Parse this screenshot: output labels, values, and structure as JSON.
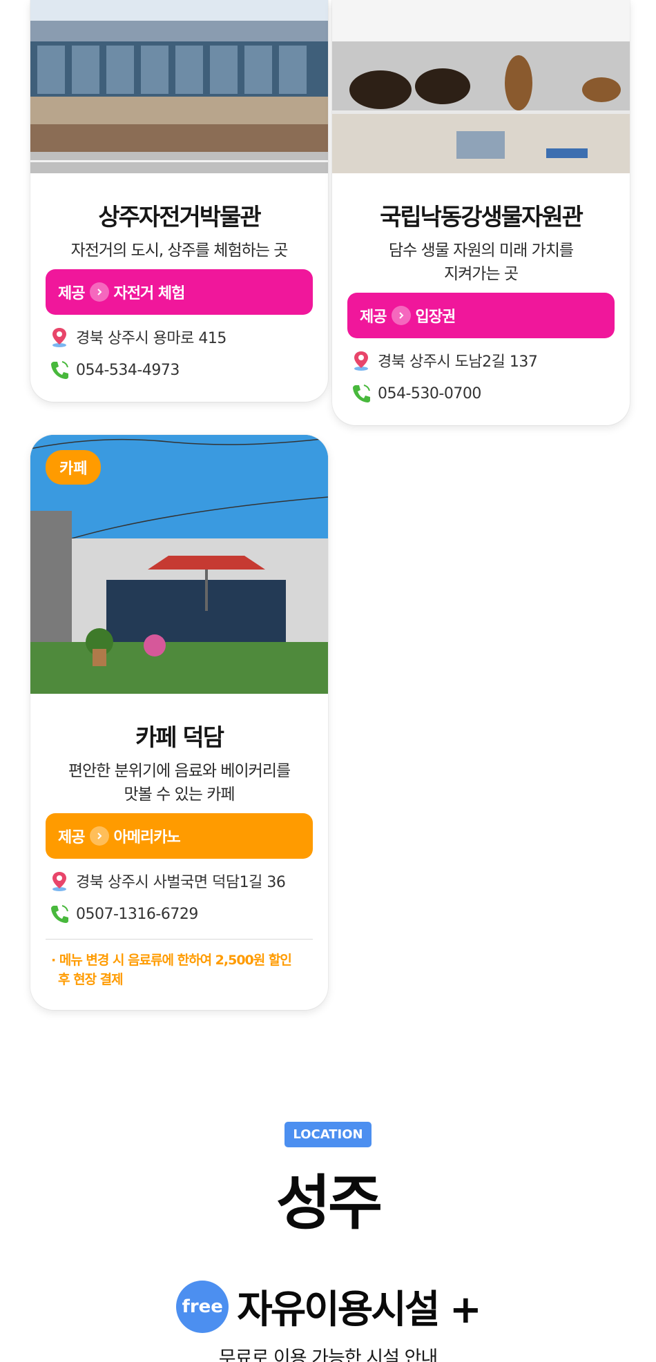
{
  "cards": [
    {
      "title": "상주자전거박물관",
      "desc_line1": "자전거의 도시, 상주를 체험하는 곳",
      "offer_prefix": "제공",
      "offer_item": "자전거 체험",
      "address": "경북 상주시 용마로 415",
      "phone": "054-534-4973"
    },
    {
      "title": "국립낙동강생물자원관",
      "desc_line1": "담수 생물 자원의 미래 가치를",
      "desc_line2": "지켜가는 곳",
      "offer_prefix": "제공",
      "offer_item": "입장권",
      "address": "경북 상주시 도남2길 137",
      "phone": "054-530-0700"
    },
    {
      "category": "카페",
      "title": "카페 덕담",
      "desc_line1": "편안한 분위기에 음료와 베이커리를",
      "desc_line2": "맛볼 수 있는 카페",
      "offer_prefix": "제공",
      "offer_item": "아메리카노",
      "address": "경북 상주시 사벌국면 덕담1길 36",
      "phone": "0507-1316-6729",
      "note_line1": "· 메뉴 변경 시 음료류에 한하여 2,500원 할인",
      "note_line2": "후 현장 결제"
    }
  ],
  "location": {
    "tag": "LOCATION",
    "title": "성주"
  },
  "free_section": {
    "badge": "free",
    "title": "자유이용시설 +",
    "subtitle": "무료로 이용 가능한 시설 안내"
  },
  "colors": {
    "pink": "#f0179b",
    "orange": "#ff9b00",
    "blue": "#4c8ff0"
  },
  "icons": [
    "location-pin-icon",
    "phone-icon",
    "chevron-right-icon"
  ]
}
